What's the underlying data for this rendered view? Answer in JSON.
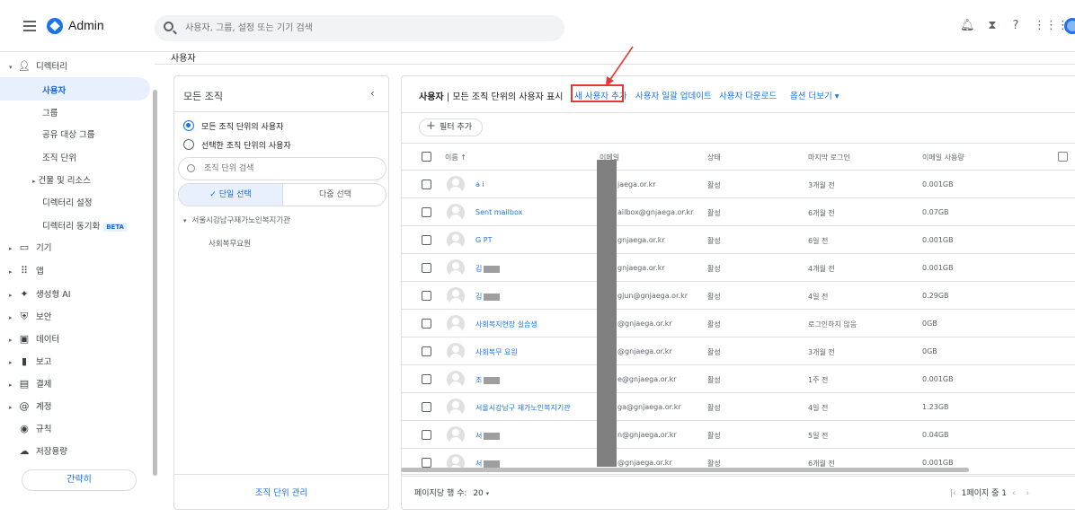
{
  "topbar": {
    "app_title": "Admin",
    "search_placeholder": "사용자, 그룹, 설정 또는 기기 검색",
    "icons": [
      "bell-icon",
      "hourglass-icon",
      "help-icon",
      "apps-grid-icon",
      "account-avatar"
    ]
  },
  "breadcrumb": "사용자",
  "sidebar": {
    "directory": "디렉터리",
    "items": [
      {
        "label": "사용자"
      },
      {
        "label": "그룹"
      },
      {
        "label": "공유 대상 그룹"
      },
      {
        "label": "조직 단위"
      },
      {
        "label": "건물 및 리소스"
      },
      {
        "label": "디렉터리 설정"
      },
      {
        "label": "디렉터리 동기화",
        "badge": "BETA"
      }
    ],
    "sections": [
      {
        "label": "기기",
        "icon": "devices-icon"
      },
      {
        "label": "앱",
        "icon": "apps-icon"
      },
      {
        "label": "생성형 AI",
        "icon": "sparkle-icon"
      },
      {
        "label": "보안",
        "icon": "shield-icon"
      },
      {
        "label": "데이터",
        "icon": "data-icon"
      },
      {
        "label": "보고",
        "icon": "bar-chart-icon"
      },
      {
        "label": "결제",
        "icon": "billing-icon"
      },
      {
        "label": "계정",
        "icon": "at-icon"
      },
      {
        "label": "규칙",
        "icon": "rules-icon"
      },
      {
        "label": "저장용량",
        "icon": "cloud-icon"
      }
    ],
    "collapse_label": "간략히"
  },
  "org_panel": {
    "title": "모든 조직",
    "radio_all": "모든 조직 단위의 사용자",
    "radio_selected": "선택한 조직 단위의 사용자",
    "search_placeholder": "조직 단위 검색",
    "seg_single": "✓ 단일 선택",
    "seg_multi": "다중 선택",
    "tree_root": "서울시강남구재가노인복지기관",
    "tree_child": "사회복무요원",
    "manage_label": "조직 단위 관리"
  },
  "users_panel": {
    "title_bold": "사용자",
    "title_rest": " | 모든 조직 단위의 사용자 표시",
    "add_user": "새 사용자 추가",
    "bulk_update": "사용자 일괄 업데이트",
    "download": "사용자 다운로드",
    "more_options": "옵션 더보기 ▾",
    "filter_label": "필터 추가",
    "columns": {
      "name": "이름 ↑",
      "email": "이메일",
      "status": "상태",
      "last_login": "마지막 로그인",
      "usage": "이메일 사용량"
    },
    "rows": [
      {
        "name": "a i",
        "email": "jaega.or.kr",
        "status": "활성",
        "last_login": "3개월 전",
        "usage": "0.001GB"
      },
      {
        "name": "Sent mailbox",
        "email": "ailbox@gnjaega.or.kr",
        "status": "활성",
        "last_login": "6개월 전",
        "usage": "0.07GB"
      },
      {
        "name": "G PT",
        "email": "gnjaega.or.kr",
        "status": "활성",
        "last_login": "6일 전",
        "usage": "0.001GB"
      },
      {
        "name": "김",
        "email": "gnjaega.or.kr",
        "status": "활성",
        "last_login": "4개월 전",
        "usage": "0.001GB"
      },
      {
        "name": "김",
        "email": "gjun@gnjaega.or.kr",
        "status": "활성",
        "last_login": "4일 전",
        "usage": "0.29GB"
      },
      {
        "name": "사회복지현장 실습생",
        "email": "@gnjaega.or.kr",
        "status": "활성",
        "last_login": "로그인하지 않음",
        "usage": "0GB"
      },
      {
        "name": "사회복무 요원",
        "email": "@gnjaega.or.kr",
        "status": "활성",
        "last_login": "3개월 전",
        "usage": "0GB"
      },
      {
        "name": "조",
        "email": "e@gnjaega.or.kr",
        "status": "활성",
        "last_login": "1주 전",
        "usage": "0.001GB"
      },
      {
        "name": "서울시강남구 재가노인복지기관",
        "email": "ga@gnjaega.or.kr",
        "status": "활성",
        "last_login": "4일 전",
        "usage": "1.23GB"
      },
      {
        "name": "서",
        "email": "n@gnjaega.or.kr",
        "status": "활성",
        "last_login": "5일 전",
        "usage": "0.04GB"
      },
      {
        "name": "서",
        "email": "@gnjaega.or.kr",
        "status": "활성",
        "last_login": "6개월 전",
        "usage": "0.001GB"
      }
    ],
    "rows_per_page_label": "페이지당 행 수:",
    "rows_per_page_value": "20",
    "page_info": "1페이지 중 1"
  },
  "colors": {
    "accent": "#1a73e8",
    "highlight_box": "#e53935"
  }
}
